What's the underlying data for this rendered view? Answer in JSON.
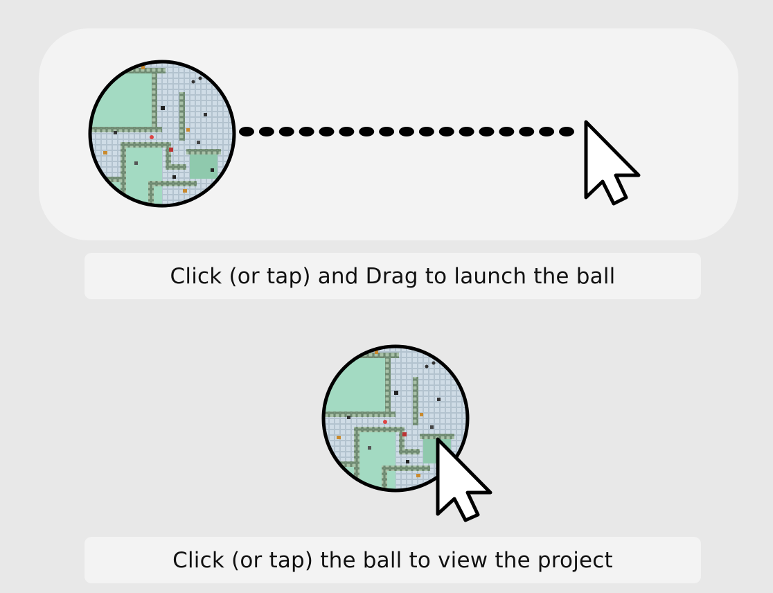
{
  "instructions": {
    "drag": {
      "text": "Click (or tap) and Drag to launch the ball",
      "ball_icon": "ball-icon",
      "trail_icon": "dotted-trail-icon",
      "cursor_icon": "cursor-arrow-icon"
    },
    "tap": {
      "text": "Click (or tap) the ball to view the project",
      "ball_icon": "ball-icon",
      "cursor_icon": "cursor-arrow-icon"
    }
  },
  "colors": {
    "page_bg": "#e8e8e8",
    "panel_bg": "#f3f3f3",
    "map_green": "#9fd6bf",
    "map_floor": "#cddbe4",
    "map_wall": "#6f8c72",
    "ink": "#000000"
  }
}
